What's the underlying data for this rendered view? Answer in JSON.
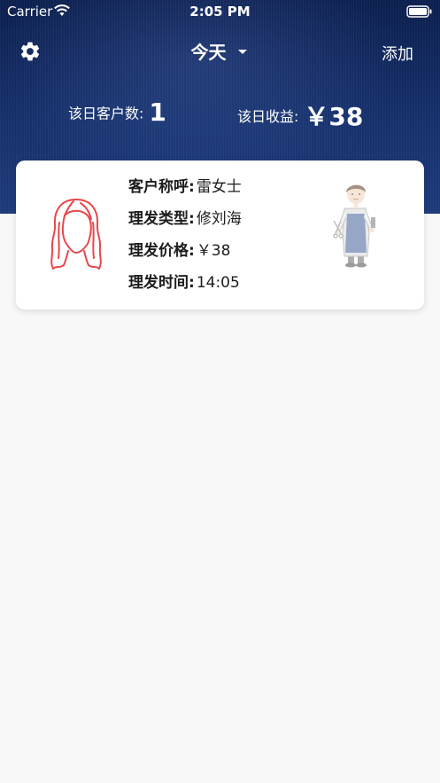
{
  "status_bar": {
    "carrier": "Carrier",
    "time": "2:05 PM"
  },
  "header": {
    "title": "今天",
    "add_label": "添加"
  },
  "summary": {
    "customers_label": "该日客户数:",
    "customers_value": "1",
    "income_label": "该日收益:",
    "income_value": "￥38"
  },
  "record": {
    "fields": [
      {
        "label": "客户称呼:",
        "value": "雷女士"
      },
      {
        "label": "理发类型:",
        "value": "修刘海"
      },
      {
        "label": "理发价格:",
        "value": "￥38"
      },
      {
        "label": "理发时间:",
        "value": "14:05"
      }
    ]
  },
  "colors": {
    "header_bg": "#15306b",
    "card_bg": "#ffffff",
    "page_bg": "#f8f8f8",
    "hair_icon": "#e8474b"
  },
  "icons": {
    "settings": "gear-icon",
    "dropdown": "caret-down-icon",
    "customer": "female-hair-icon",
    "barber": "barber-illustration"
  }
}
